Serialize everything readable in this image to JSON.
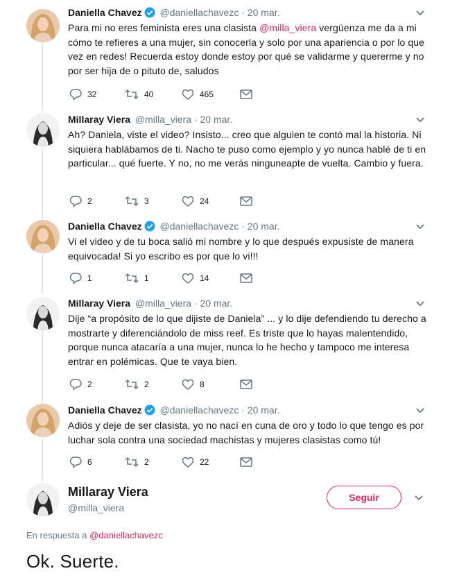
{
  "tweets": [
    {
      "name": "Daniella Chavez",
      "verified": true,
      "handle": "@daniellachavezc",
      "dot": "·",
      "time": "20 mar.",
      "text_before": "Para mi no eres feminista eres una clasista ",
      "mention": "@milla_viera",
      "text_after": " vergüenza me da a mi cómo te refieres a una mujer, sin conocerla y solo por una apariencia o por lo que vez en redes! Recuerda estoy donde estoy por qué se validarme y quererme y no por ser hija de o pituto de, saludos",
      "replies": "32",
      "retweets": "40",
      "likes": "465"
    },
    {
      "name": "Millaray Viera",
      "verified": false,
      "handle": "@milla_viera",
      "dot": "·",
      "time": "20 mar.",
      "text_before": "Ah? Daniela, viste el video? Insisto... creo que alguien te contó mal la historia. Ni siquiera hablábamos de ti. Nacho te puso como ejemplo y yo nunca hablé de ti en particular... qué fuerte. Y no, no me verás ninguneарte de vuelta. Cambio y fuera.",
      "mention": "",
      "text_after": "",
      "replies": "2",
      "retweets": "3",
      "likes": "24"
    },
    {
      "name": "Daniella Chavez",
      "verified": true,
      "handle": "@daniellachavezc",
      "dot": "·",
      "time": "20 mar.",
      "text_before": "Vi el video y de tu boca salió mi nombre y lo que después expusiste de manera equivocada! Si yo escribo es por que lo vi!!!",
      "mention": "",
      "text_after": "",
      "replies": "1",
      "retweets": "1",
      "likes": "14"
    },
    {
      "name": "Millaray Viera",
      "verified": false,
      "handle": "@milla_viera",
      "dot": "·",
      "time": "20 mar.",
      "text_before": "Dije “a propósito de lo que dijiste de Daniela” ... y lo dije defendiendo tu derecho a mostrarte y diferenciándolo de miss reef. Es triste que lo hayas malentendido, porque nunca atacaría a una mujer, nunca lo he hecho y tampoco me interesa entrar en polémicas. Que te vaya bien.",
      "mention": "",
      "text_after": "",
      "replies": "2",
      "retweets": "2",
      "likes": "8"
    },
    {
      "name": "Daniella Chavez",
      "verified": true,
      "handle": "@daniellachavezc",
      "dot": "·",
      "time": "20 mar.",
      "text_before": "Adiós y deje de ser clasista, yo no nací en cuna de oro y todo lo que tengo es por luchar sola contra una sociedad machistas y mujeres clasistas como tú!",
      "mention": "",
      "text_after": "",
      "replies": "6",
      "retweets": "2",
      "likes": "22"
    }
  ],
  "main": {
    "name": "Millaray Viera",
    "handle": "@milla_viera",
    "follow_label": "Seguir",
    "reply_to_prefix": "En respuesta a ",
    "reply_to_handle": "@daniellachavezc",
    "text": "Ok. Suerte."
  },
  "colors": {
    "accent": "#e0245e",
    "secondary_text": "#657786",
    "verified": "#1da1f2",
    "thread_line": "#e1e8ed"
  },
  "icons": {
    "reply": "reply-icon",
    "retweet": "retweet-icon",
    "like": "heart-icon",
    "dm": "envelope-icon",
    "caret": "chevron-down-icon",
    "verified": "verified-badge-icon"
  }
}
